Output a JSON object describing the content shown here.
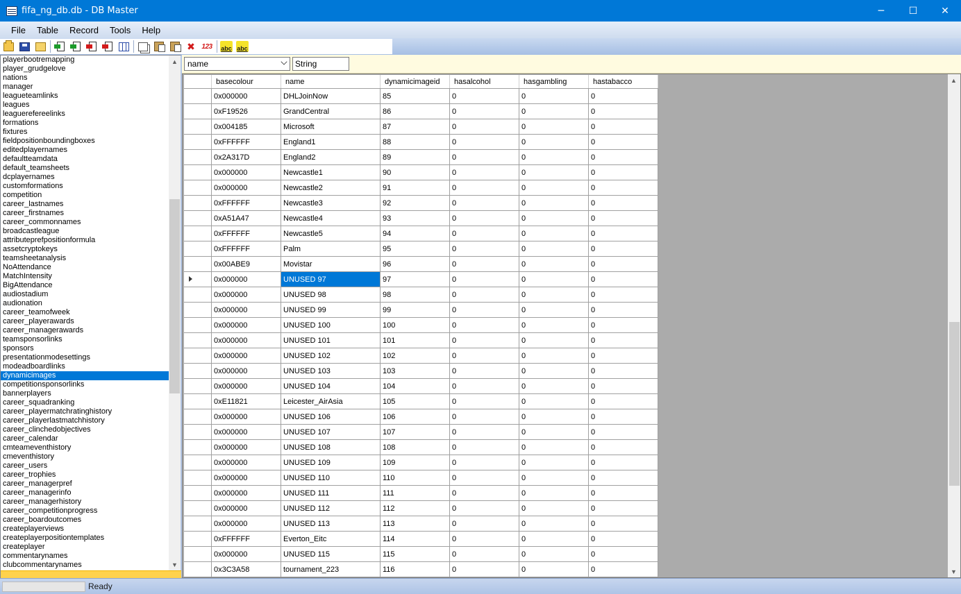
{
  "window": {
    "title": "fifa_ng_db.db - DB Master",
    "minimize_glyph": "─",
    "maximize_glyph": "☐",
    "close_glyph": "✕"
  },
  "menu": [
    "File",
    "Table",
    "Record",
    "Tools",
    "Help"
  ],
  "toolbar": {
    "icons": [
      "open-icon",
      "save-icon",
      "open-folder-icon",
      "import-icon",
      "import-all-icon",
      "export-icon",
      "export-all-icon",
      "grid-icon",
      "copy-icon",
      "paste-icon",
      "paste-special-icon",
      "delete-icon",
      "numbers-icon",
      "spellcheck-icon",
      "spellcheck-all-icon"
    ],
    "abc_label": "abc",
    "del_glyph": "✖",
    "num_label": "123"
  },
  "tables": {
    "items": [
      "playerbootremapping",
      "player_grudgelove",
      "nations",
      "manager",
      "leagueteamlinks",
      "leagues",
      "leaguerefereelinks",
      "formations",
      "fixtures",
      "fieldpositionboundingboxes",
      "editedplayernames",
      "defaultteamdata",
      "default_teamsheets",
      "dcplayernames",
      "customformations",
      "competition",
      "career_lastnames",
      "career_firstnames",
      "career_commonnames",
      "broadcastleague",
      "attributeprefpositionformula",
      "assetcryptokeys",
      "teamsheetanalysis",
      "NoAttendance",
      "MatchIntensity",
      "BigAttendance",
      "audiostadium",
      "audionation",
      "career_teamofweek",
      "career_playerawards",
      "career_managerawards",
      "teamsponsorlinks",
      "sponsors",
      "presentationmodesettings",
      "modeadboardlinks",
      "dynamicimages",
      "competitionsponsorlinks",
      "bannerplayers",
      "career_squadranking",
      "career_playermatchratinghistory",
      "career_playerlastmatchhistory",
      "career_clinchedobjectives",
      "career_calendar",
      "cmteameventhistory",
      "cmeventhistory",
      "career_users",
      "career_trophies",
      "career_managerpref",
      "career_managerinfo",
      "career_managerhistory",
      "career_competitionprogress",
      "career_boardoutcomes",
      "createplayerviews",
      "createplayerpositiontemplates",
      "createplayer",
      "commentarynames",
      "clubcommentarynames"
    ],
    "selected": "dynamicimages"
  },
  "filter": {
    "field": "name",
    "type": "String"
  },
  "grid": {
    "columns": [
      "basecolour",
      "name",
      "dynamicimageid",
      "hasalcohol",
      "hasgambling",
      "hastabacco"
    ],
    "current_row_index": 12,
    "rows": [
      [
        "0x000000",
        "DHLJoinNow",
        "85",
        "0",
        "0",
        "0"
      ],
      [
        "0xF19526",
        "GrandCentral",
        "86",
        "0",
        "0",
        "0"
      ],
      [
        "0x004185",
        "Microsoft",
        "87",
        "0",
        "0",
        "0"
      ],
      [
        "0xFFFFFF",
        "England1",
        "88",
        "0",
        "0",
        "0"
      ],
      [
        "0x2A317D",
        "England2",
        "89",
        "0",
        "0",
        "0"
      ],
      [
        "0x000000",
        "Newcastle1",
        "90",
        "0",
        "0",
        "0"
      ],
      [
        "0x000000",
        "Newcastle2",
        "91",
        "0",
        "0",
        "0"
      ],
      [
        "0xFFFFFF",
        "Newcastle3",
        "92",
        "0",
        "0",
        "0"
      ],
      [
        "0xA51A47",
        "Newcastle4",
        "93",
        "0",
        "0",
        "0"
      ],
      [
        "0xFFFFFF",
        "Newcastle5",
        "94",
        "0",
        "0",
        "0"
      ],
      [
        "0xFFFFFF",
        "Palm",
        "95",
        "0",
        "0",
        "0"
      ],
      [
        "0x00ABE9",
        "Movistar",
        "96",
        "0",
        "0",
        "0"
      ],
      [
        "0x000000",
        "UNUSED 97",
        "97",
        "0",
        "0",
        "0"
      ],
      [
        "0x000000",
        "UNUSED 98",
        "98",
        "0",
        "0",
        "0"
      ],
      [
        "0x000000",
        "UNUSED 99",
        "99",
        "0",
        "0",
        "0"
      ],
      [
        "0x000000",
        "UNUSED 100",
        "100",
        "0",
        "0",
        "0"
      ],
      [
        "0x000000",
        "UNUSED 101",
        "101",
        "0",
        "0",
        "0"
      ],
      [
        "0x000000",
        "UNUSED 102",
        "102",
        "0",
        "0",
        "0"
      ],
      [
        "0x000000",
        "UNUSED 103",
        "103",
        "0",
        "0",
        "0"
      ],
      [
        "0x000000",
        "UNUSED 104",
        "104",
        "0",
        "0",
        "0"
      ],
      [
        "0xE11821",
        "Leicester_AirAsia",
        "105",
        "0",
        "0",
        "0"
      ],
      [
        "0x000000",
        "UNUSED 106",
        "106",
        "0",
        "0",
        "0"
      ],
      [
        "0x000000",
        "UNUSED 107",
        "107",
        "0",
        "0",
        "0"
      ],
      [
        "0x000000",
        "UNUSED 108",
        "108",
        "0",
        "0",
        "0"
      ],
      [
        "0x000000",
        "UNUSED 109",
        "109",
        "0",
        "0",
        "0"
      ],
      [
        "0x000000",
        "UNUSED 110",
        "110",
        "0",
        "0",
        "0"
      ],
      [
        "0x000000",
        "UNUSED 111",
        "111",
        "0",
        "0",
        "0"
      ],
      [
        "0x000000",
        "UNUSED 112",
        "112",
        "0",
        "0",
        "0"
      ],
      [
        "0x000000",
        "UNUSED 113",
        "113",
        "0",
        "0",
        "0"
      ],
      [
        "0xFFFFFF",
        "Everton_Eitc",
        "114",
        "0",
        "0",
        "0"
      ],
      [
        "0x000000",
        "UNUSED 115",
        "115",
        "0",
        "0",
        "0"
      ],
      [
        "0x3C3A58",
        "tournament_223",
        "116",
        "0",
        "0",
        "0"
      ]
    ]
  },
  "status": {
    "text": "Ready"
  },
  "colors": {
    "titlebar": "#0078d7",
    "selection": "#0078d7",
    "filter_bg": "#fffbe0",
    "grid_empty": "#ababab"
  }
}
